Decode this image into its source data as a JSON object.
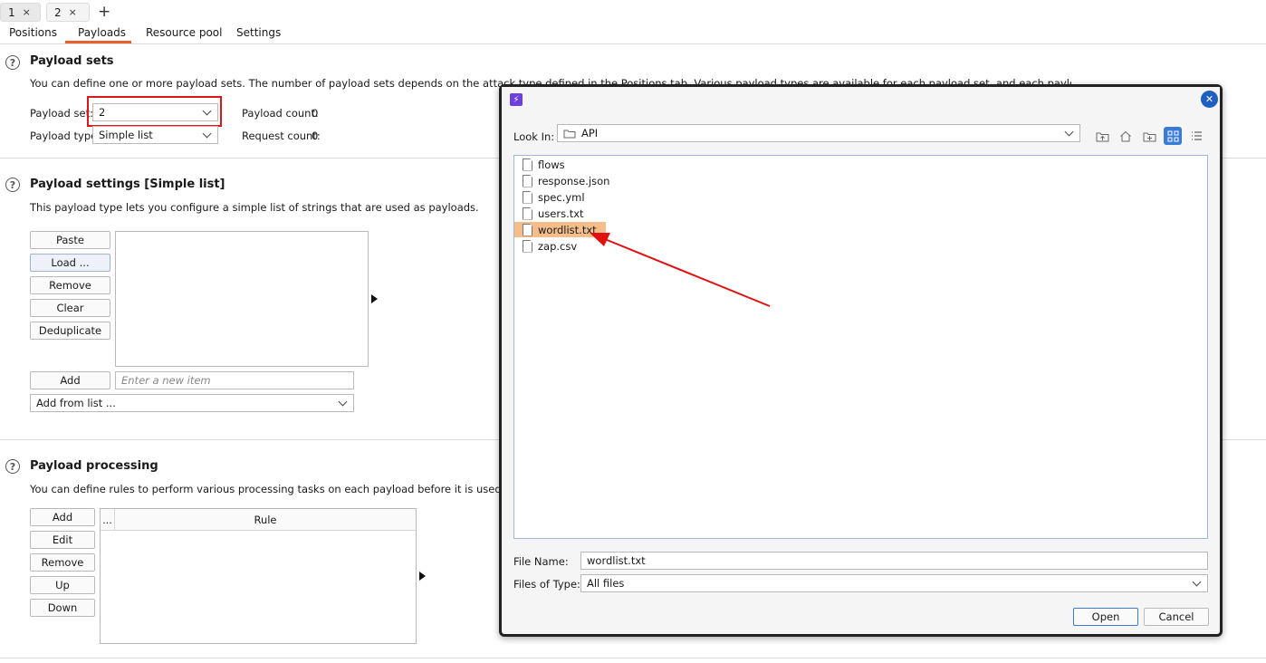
{
  "top_tabs": [
    {
      "label": "1",
      "close": "×"
    },
    {
      "label": "2",
      "close": "×"
    }
  ],
  "add_tab": "+",
  "nav_tabs": [
    "Positions",
    "Payloads",
    "Resource pool",
    "Settings"
  ],
  "help_glyph": "?",
  "payload_sets": {
    "title": "Payload sets",
    "description": "You can define one or more payload sets. The number of payload sets depends on the attack type defined in the Positions tab. Various payload types are available for each payload set, and each payload type can be customized in different ways.",
    "set_label": "Payload set:",
    "set_value": "2",
    "type_label": "Payload type:",
    "type_value": "Simple list",
    "count_label": "Payload count:",
    "count_value": "0",
    "request_label": "Request count:",
    "request_value": "0"
  },
  "payload_settings": {
    "title": "Payload settings [Simple list]",
    "description": "This payload type lets you configure a simple list of strings that are used as payloads.",
    "buttons": [
      "Paste",
      "Load ...",
      "Remove",
      "Clear",
      "Deduplicate"
    ],
    "add_label": "Add",
    "new_item_placeholder": "Enter a new item",
    "add_from_list": "Add from list ..."
  },
  "payload_processing": {
    "title": "Payload processing",
    "description": "You can define rules to perform various processing tasks on each payload before it is used.",
    "buttons": [
      "Add",
      "Edit",
      "Remove",
      "Up",
      "Down"
    ],
    "col_enabled": "...",
    "col_rule": "Rule"
  },
  "dialog": {
    "app_icon": "⚡",
    "close_glyph": "✕",
    "look_in_label": "Look In:",
    "look_in_value": "API",
    "toolbar_icons": [
      "up-folder-icon",
      "home-icon",
      "new-folder-icon",
      "grid-view-icon",
      "details-view-icon"
    ],
    "files": [
      "flows",
      "response.json",
      "spec.yml",
      "users.txt",
      "wordlist.txt",
      "zap.csv"
    ],
    "selected_file": "wordlist.txt",
    "file_name_label": "File Name:",
    "file_name_value": "wordlist.txt",
    "files_of_type_label": "Files of Type:",
    "files_of_type_value": "All files",
    "open_label": "Open",
    "cancel_label": "Cancel"
  },
  "colors": {
    "accent": "#e8602c",
    "highlight_box": "#d81919",
    "selection": "#f4bd8a",
    "arrow": "#e01010",
    "dialog_close": "#1f5fbf"
  }
}
